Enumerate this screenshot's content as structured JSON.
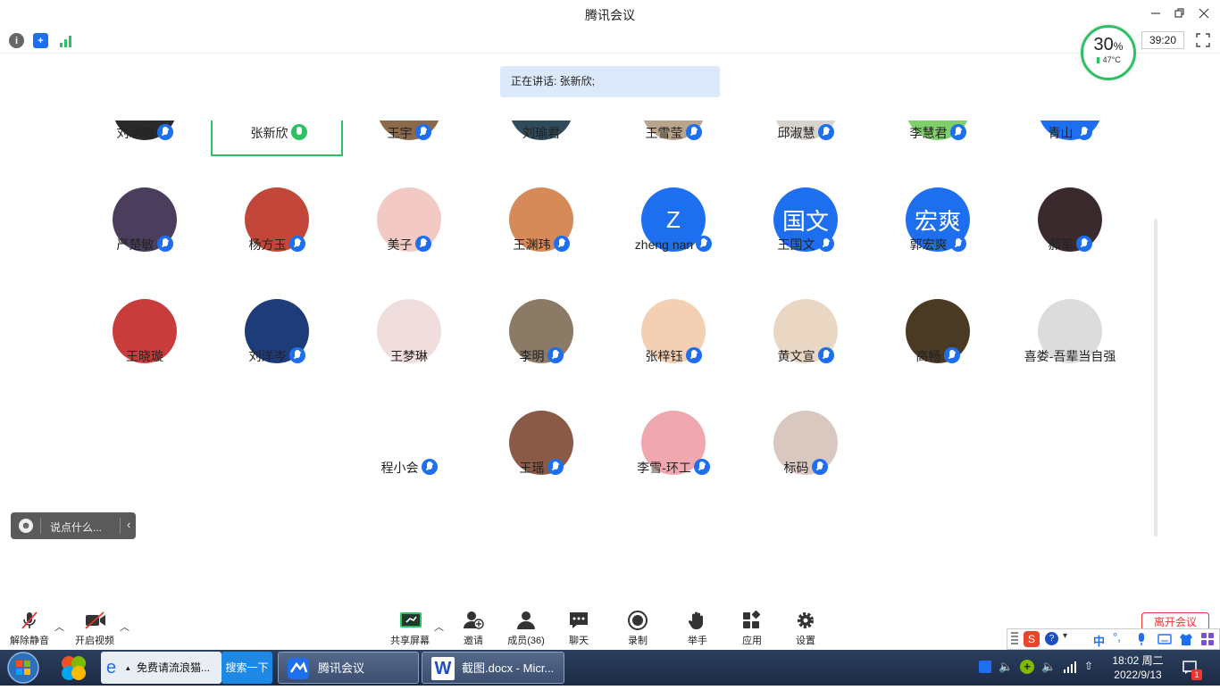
{
  "window": {
    "title": "腾讯会议"
  },
  "topbar": {
    "timer": "39:20"
  },
  "gauge": {
    "percent": "30",
    "percent_sign": "%",
    "temp": "47°C"
  },
  "speaking": {
    "text": "正在讲话: 张新欣;"
  },
  "participants": [
    {
      "name": "刘承昭",
      "mic": "muted",
      "avatar_color": "#2a2a2a",
      "avatar_text": ""
    },
    {
      "name": "张新欣",
      "mic": "on",
      "avatar_color": "#ffffff",
      "avatar_text": "",
      "active": true
    },
    {
      "name": "王宇",
      "mic": "muted",
      "avatar_color": "#8a6a4a",
      "avatar_text": ""
    },
    {
      "name": "刘瑜君",
      "mic": "none",
      "avatar_color": "#2f4b5a",
      "avatar_text": ""
    },
    {
      "name": "王雪莹",
      "mic": "muted",
      "avatar_color": "#b9a48c",
      "avatar_text": ""
    },
    {
      "name": "邱淑慧",
      "mic": "muted",
      "avatar_color": "#d8d3cc",
      "avatar_text": ""
    },
    {
      "name": "李慧君",
      "mic": "muted",
      "avatar_color": "#7fd06a",
      "avatar_text": ""
    },
    {
      "name": "青山",
      "mic": "muted",
      "avatar_color": "#1e6ff0",
      "avatar_text": "青山"
    },
    {
      "name": "严楚敏",
      "mic": "muted",
      "avatar_color": "#4a3e5c",
      "avatar_text": ""
    },
    {
      "name": "杨方玉",
      "mic": "muted",
      "avatar_color": "#c2473a",
      "avatar_text": ""
    },
    {
      "name": "美子",
      "mic": "muted",
      "avatar_color": "#f3c9c4",
      "avatar_text": ""
    },
    {
      "name": "王渊玮",
      "mic": "muted",
      "avatar_color": "#d68a5a",
      "avatar_text": ""
    },
    {
      "name": "zheng nan",
      "mic": "muted",
      "avatar_color": "#1e6ff0",
      "avatar_text": "Z"
    },
    {
      "name": "王国文",
      "mic": "muted",
      "avatar_color": "#1e6ff0",
      "avatar_text": "国文"
    },
    {
      "name": "郭宏爽",
      "mic": "muted",
      "avatar_color": "#1e6ff0",
      "avatar_text": "宏爽"
    },
    {
      "name": "郝军",
      "mic": "muted",
      "avatar_color": "#3a2a2e",
      "avatar_text": ""
    },
    {
      "name": "王晓璇",
      "mic": "none",
      "avatar_color": "#c83c3c",
      "avatar_text": ""
    },
    {
      "name": "刘洋岑",
      "mic": "muted",
      "avatar_color": "#1e3c7a",
      "avatar_text": ""
    },
    {
      "name": "王梦琳",
      "mic": "none",
      "avatar_color": "#f0dede",
      "avatar_text": ""
    },
    {
      "name": "李明",
      "mic": "muted",
      "avatar_color": "#8a7a66",
      "avatar_text": ""
    },
    {
      "name": "张梓钰",
      "mic": "muted",
      "avatar_color": "#f3d0b4",
      "avatar_text": ""
    },
    {
      "name": "黄文宣",
      "mic": "muted",
      "avatar_color": "#e9d7c4",
      "avatar_text": ""
    },
    {
      "name": "高畅",
      "mic": "muted",
      "avatar_color": "#4a3a24",
      "avatar_text": ""
    },
    {
      "name": "喜娄-吾辈当自强",
      "mic": "none",
      "avatar_color": "#dcdcdc",
      "avatar_text": ""
    },
    {
      "name": "程小会",
      "mic": "muted",
      "avatar_color": "#ffffff",
      "avatar_text": ""
    },
    {
      "name": "王瑶",
      "mic": "muted",
      "avatar_color": "#8a5a46",
      "avatar_text": ""
    },
    {
      "name": "李雪-环工",
      "mic": "muted",
      "avatar_color": "#f0a8b0",
      "avatar_text": ""
    },
    {
      "name": "标码",
      "mic": "muted",
      "avatar_color": "#d8c8c0",
      "avatar_text": ""
    }
  ],
  "chat": {
    "placeholder": "说点什么..."
  },
  "toolbar": {
    "unmute": "解除静音",
    "video": "开启视频",
    "share": "共享屏幕",
    "invite": "邀请",
    "members": "成员(36)",
    "chat": "聊天",
    "record": "录制",
    "raise_hand": "举手",
    "apps": "应用",
    "settings": "设置",
    "end": "离开会议"
  },
  "ime": {
    "lang": "中"
  },
  "taskbar": {
    "ie_task": "免费请流浪猫...",
    "search": "搜索一下",
    "meeting_task": "腾讯会议",
    "word_task": "截图.docx - Micr...",
    "time": "18:02 周二",
    "date": "2022/9/13",
    "badge": "1"
  }
}
